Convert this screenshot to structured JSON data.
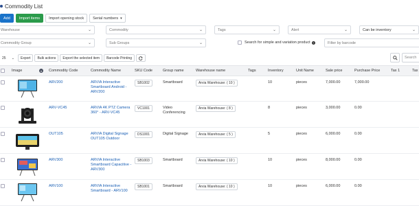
{
  "page": {
    "title": "Commodity List"
  },
  "toolbar": {
    "add_label": "Add",
    "import_items_label": "Import items",
    "import_opening_stock_label": "Import opening stock",
    "serial_numbers_label": "Serial numbers"
  },
  "filters": {
    "warehouse": "Warehouse",
    "commodity": "Commodity",
    "tags": "Tags",
    "alert": "Alert",
    "inventory": "Can be inventory",
    "commodity_group": "Commodity Group",
    "sub_groups": "Sub Groups",
    "search_simple_label": "Search for simple and variation product",
    "filter_by_barcode": "Filter by barcode"
  },
  "table_tools": {
    "page_size": "25",
    "export": "Export",
    "bulk_actions": "Bulk actions",
    "export_selected": "Export the selected item",
    "barcode_printing": "Barcode Printing",
    "search_placeholder": "Search"
  },
  "columns": [
    "Image",
    "Commodity Code",
    "Commodity Name",
    "SKU Code",
    "Group name",
    "Warehouse name",
    "Tags",
    "Inventory",
    "Unit Name",
    "Sale price",
    "Purchase Price",
    "Tax 1",
    "Tax"
  ],
  "rows": [
    {
      "code": "ARV200",
      "name": "ARVIA Interactive Smartboard Android - ARV200",
      "sku": "SB1002",
      "group": "Smartboard",
      "warehouse": "Arvia Warehouse: ( 10 )",
      "inventory": "10",
      "unit": "pieces",
      "sale": "7,000.00",
      "purchase": "7,000.00",
      "image_icon": "smartboard-stand-icon"
    },
    {
      "code": "ARV-VC45",
      "name": "ARVIA 4K PTZ Camera 360° - ARV-VC45",
      "sku": "VC1001",
      "group": "Video Conferencing",
      "warehouse": "Arvia Warehouse: ( 8 )",
      "inventory": "8",
      "unit": "pieces",
      "sale": "3,000.00",
      "purchase": "0.00",
      "image_icon": "ptz-camera-icon"
    },
    {
      "code": "OUT105",
      "name": "ARVIA Digital Signage OUT105 Outdoor",
      "sku": "DS1001",
      "group": "Digital Signage",
      "warehouse": "Arvia Warehouse: ( 5 )",
      "inventory": "5",
      "unit": "pieces",
      "sale": "6,000.00",
      "purchase": "0.00",
      "image_icon": "digital-signage-icon"
    },
    {
      "code": "ARV300",
      "name": "ARVIA Interactive Smartboard Capacitive - ARV300",
      "sku": "SB1003",
      "group": "Smartboard",
      "warehouse": "Arvia Warehouse: ( 10 )",
      "inventory": "10",
      "unit": "pieces",
      "sale": "8,000.00",
      "purchase": "0.00",
      "image_icon": "smartboard-trolley-icon"
    },
    {
      "code": "ARV100",
      "name": "ARVIA Interactive Smartboard - ARV100",
      "sku": "SB1001",
      "group": "Smartboard",
      "warehouse": "Arvia Warehouse: ( 10 )",
      "inventory": "10",
      "unit": "pieces",
      "sale": "6,000.00",
      "purchase": "0.00",
      "image_icon": "smartboard-stand-icon"
    }
  ],
  "colors": {
    "primary": "#1a73c9",
    "success": "#2b9b4b",
    "link": "#1a5fb4"
  }
}
